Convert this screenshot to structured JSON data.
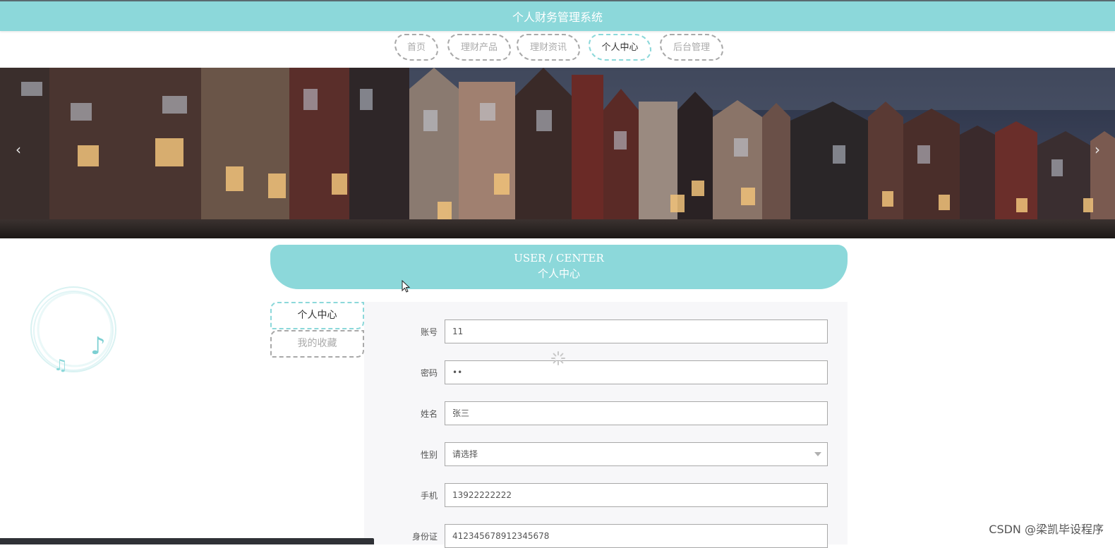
{
  "header": {
    "title": "个人财务管理系统"
  },
  "nav": {
    "items": [
      {
        "label": "首页",
        "active": false
      },
      {
        "label": "理财产品",
        "active": false
      },
      {
        "label": "理财资讯",
        "active": false
      },
      {
        "label": "个人中心",
        "active": true
      },
      {
        "label": "后台管理",
        "active": false
      }
    ]
  },
  "banner": {
    "prev_icon": "chevron-left-icon",
    "next_icon": "chevron-right-icon"
  },
  "section": {
    "title_en": "USER / CENTER",
    "title_zh": "个人中心"
  },
  "sidebar": {
    "tabs": [
      {
        "label": "个人中心",
        "active": true
      },
      {
        "label": "我的收藏",
        "active": false
      }
    ]
  },
  "form": {
    "account": {
      "label": "账号",
      "value": "11"
    },
    "password": {
      "label": "密码",
      "value": "••"
    },
    "name": {
      "label": "姓名",
      "value": "张三"
    },
    "gender": {
      "label": "性别",
      "value": "请选择"
    },
    "phone": {
      "label": "手机",
      "value": "13922222222"
    },
    "id_card": {
      "label": "身份证",
      "value": "412345678912345678"
    }
  },
  "watermark": "CSDN @梁凯毕设程序",
  "colors": {
    "accent": "#8cd8da",
    "text_muted": "#aaaaaa",
    "border_dashed": "#a9a9a9"
  }
}
